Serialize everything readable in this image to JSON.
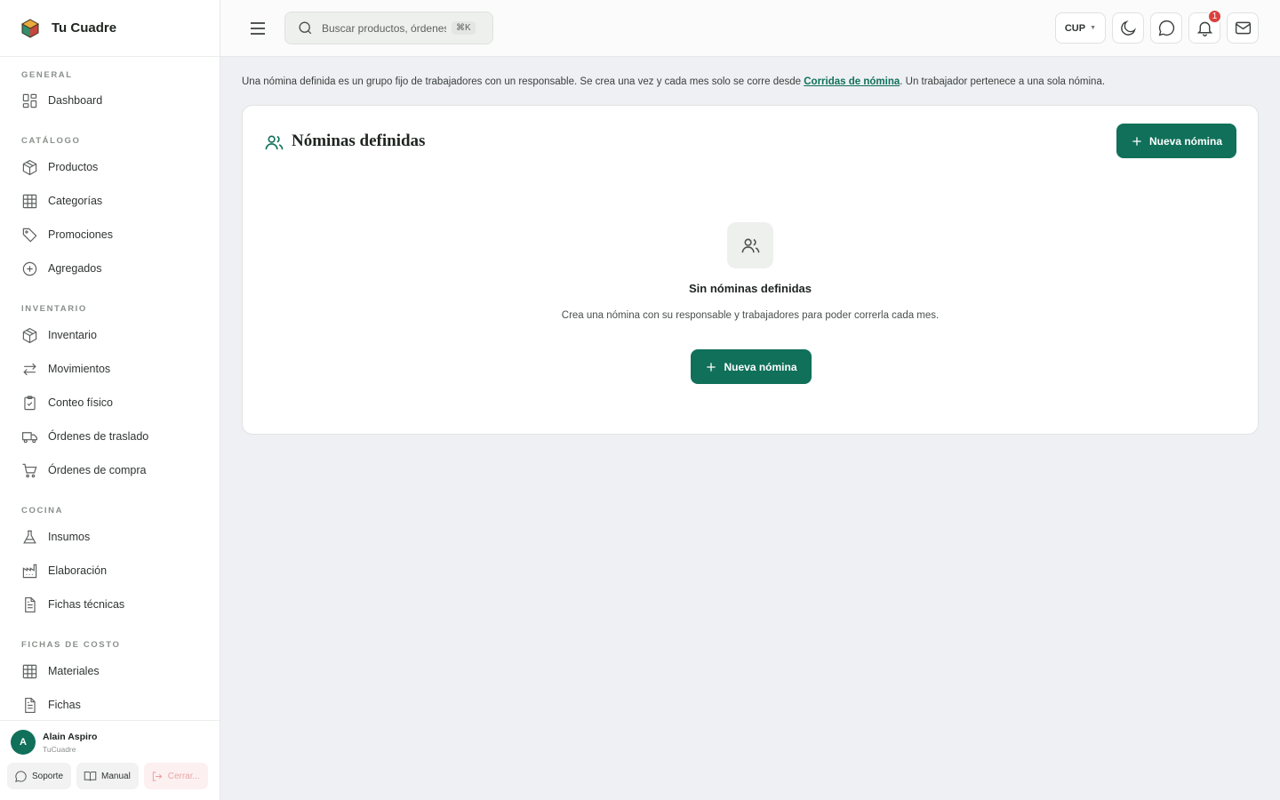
{
  "brand": {
    "name": "Tu Cuadre",
    "icon": "cube-logo-icon"
  },
  "sidebar": {
    "sections": [
      {
        "title": "GENERAL",
        "items": [
          {
            "label": "Dashboard",
            "icon": "dashboard-icon"
          }
        ]
      },
      {
        "title": "CATÁLOGO",
        "items": [
          {
            "label": "Productos",
            "icon": "box-icon"
          },
          {
            "label": "Categorías",
            "icon": "grid-icon"
          },
          {
            "label": "Promociones",
            "icon": "tag-icon"
          },
          {
            "label": "Agregados",
            "icon": "plus-circle-icon"
          }
        ]
      },
      {
        "title": "INVENTARIO",
        "items": [
          {
            "label": "Inventario",
            "icon": "box-icon"
          },
          {
            "label": "Movimientos",
            "icon": "arrows-icon"
          },
          {
            "label": "Conteo físico",
            "icon": "clipboard-check-icon"
          },
          {
            "label": "Órdenes de traslado",
            "icon": "truck-icon"
          },
          {
            "label": "Órdenes de compra",
            "icon": "cart-icon"
          }
        ]
      },
      {
        "title": "COCINA",
        "items": [
          {
            "label": "Insumos",
            "icon": "flask-icon"
          },
          {
            "label": "Elaboración",
            "icon": "factory-icon"
          },
          {
            "label": "Fichas técnicas",
            "icon": "document-icon"
          }
        ]
      },
      {
        "title": "FICHAS DE COSTO",
        "items": [
          {
            "label": "Materiales",
            "icon": "grid-icon"
          },
          {
            "label": "Fichas",
            "icon": "document-icon"
          }
        ]
      }
    ]
  },
  "user": {
    "initial": "A",
    "name": "Alain Aspiro",
    "org": "TuCuadre",
    "actions": {
      "support": "Soporte",
      "manual": "Manual",
      "logout": "Cerrar..."
    }
  },
  "topbar": {
    "search_placeholder": "Buscar productos, órdenes...",
    "shortcut": "⌘K",
    "currency": "CUP",
    "notification_count": "1"
  },
  "main": {
    "info_before": "Una nómina definida es un grupo fijo de trabajadores con un responsable. Se crea una vez y cada mes solo se corre desde ",
    "info_link": "Corridas de nómina",
    "info_after": ". Un trabajador pertenece a una sola nómina.",
    "card": {
      "title": "Nóminas definidas",
      "new_button": "Nueva nómina",
      "empty_title": "Sin nóminas definidas",
      "empty_description": "Crea una nómina con su responsable y trabajadores para poder correrla cada mes.",
      "empty_button": "Nueva nómina"
    }
  },
  "colors": {
    "accent": "#10705a",
    "badge": "#d9413f",
    "background": "#eef0f4"
  }
}
